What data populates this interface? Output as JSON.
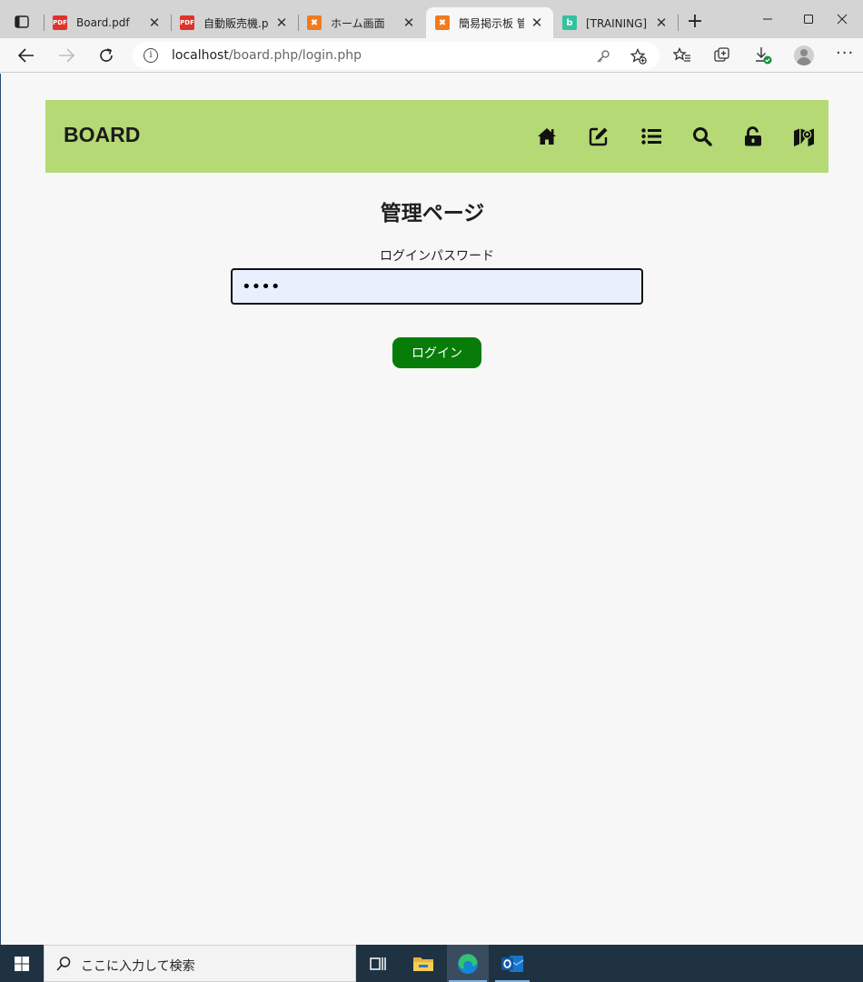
{
  "browser": {
    "tabs": [
      {
        "title": "Board.pdf",
        "favicon": "pdf-icon"
      },
      {
        "title": "自動販売機.pdf",
        "favicon": "pdf-icon"
      },
      {
        "title": "ホーム画面",
        "favicon": "xampp-icon"
      },
      {
        "title": "簡易掲示板 管理",
        "favicon": "xampp-icon",
        "active": true
      },
      {
        "title": "[TRAINING] 研修",
        "favicon": "training-icon"
      }
    ],
    "url_host": "localhost",
    "url_path": "/board.php/login.php"
  },
  "site": {
    "brand": "BOARD",
    "header_color": "#b5d975",
    "nav_icons": [
      "home-icon",
      "edit-icon",
      "list-icon",
      "search-icon",
      "unlock-icon",
      "map-icon"
    ]
  },
  "login": {
    "title": "管理ページ",
    "password_label": "ログインパスワード",
    "password_value": "••••",
    "button_label": "ログイン",
    "button_color": "#087c08"
  },
  "taskbar": {
    "search_placeholder": "ここに入力して検索",
    "apps": [
      "task-view-icon",
      "file-explorer-icon",
      "edge-icon",
      "outlook-icon"
    ]
  }
}
